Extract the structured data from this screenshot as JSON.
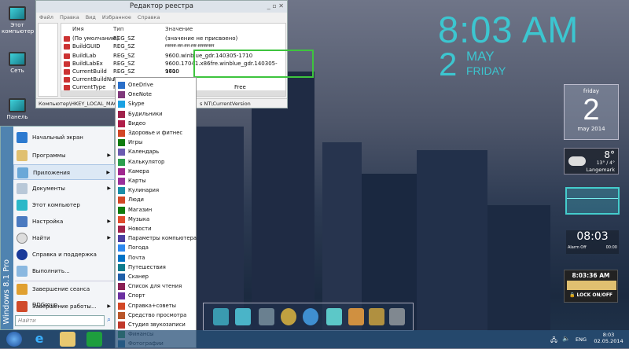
{
  "desktop_icons": [
    "Этот компьютер",
    "Сеть",
    "Панель"
  ],
  "regedit": {
    "title": "Редактор реестра",
    "menu": [
      "Файл",
      "Правка",
      "Вид",
      "Избранное",
      "Справка"
    ],
    "columns": [
      "Имя",
      "Тип",
      "Значение"
    ],
    "rows": [
      {
        "name": "(По умолчанию)",
        "type": "REG_SZ",
        "value": "(значение не присвоено)"
      },
      {
        "name": "BuildGUID",
        "type": "REG_SZ",
        "value": "ffffffff-ffff-ffff-ffff-ffffffffffff"
      },
      {
        "name": "BuildLab",
        "type": "REG_SZ",
        "value": "9600.winblue_gdr.140305-1710"
      },
      {
        "name": "BuildLabEx",
        "type": "REG_SZ",
        "value": "9600.17041.x86fre.winblue_gdr.140305-1710"
      },
      {
        "name": "CurrentBuild",
        "type": "REG_SZ",
        "value": "9600"
      },
      {
        "name": "CurrentBuildNu...",
        "type": "RE",
        "value": ""
      },
      {
        "name": "CurrentType",
        "type": "RE",
        "value": "Free"
      }
    ],
    "status": "Компьютер\\HKEY_LOCAL_MACH",
    "status_tail": "s NT\\CurrentVersion"
  },
  "start_menu": {
    "edition": "Windows 8.1 Pro",
    "items": [
      "Начальный экран",
      "Программы",
      "Приложения",
      "Документы",
      "Этот компьютер",
      "Настройка",
      "Найти",
      "Справка и поддержка",
      "Выполнить...",
      "Завершение сеанса DDGroup...",
      "Завершение работы..."
    ],
    "search_placeholder": "Найти"
  },
  "apps": [
    "OneDrive",
    "OneNote",
    "Skype",
    "Будильники",
    "Видео",
    "Здоровье и фитнес",
    "Игры",
    "Календарь",
    "Калькулятор",
    "Камера",
    "Карты",
    "Кулинария",
    "Люди",
    "Магазин",
    "Музыка",
    "Новости",
    "Параметры компьютера",
    "Погода",
    "Почта",
    "Путешествия",
    "Сканер",
    "Список для чтения",
    "Спорт",
    "Справка+советы",
    "Средство просмотра",
    "Студия звукозаписи",
    "Финансы",
    "Фотографии"
  ],
  "app_colors": [
    "#2a6fc9",
    "#80397b",
    "#1ba1e2",
    "#a0224a",
    "#b01e4a",
    "#d24726",
    "#107c10",
    "#6b5bb1",
    "#2d9f4f",
    "#a0288f",
    "#9b2f9b",
    "#1b8ea8",
    "#d24726",
    "#107c10",
    "#e04b2d",
    "#a0224a",
    "#4b3fa0",
    "#2d89ef",
    "#0072c6",
    "#0f7c8c",
    "#1f5fa8",
    "#8a2054",
    "#6b2fa0",
    "#d24726",
    "#b8562a",
    "#c0392b",
    "#2d9f4f",
    "#1f6f9f"
  ],
  "clock": {
    "time": "8:03 AM",
    "day": "2",
    "month": "MAY",
    "weekday": "FRIDAY"
  },
  "calendar_widget": {
    "weekday": "friday",
    "day": "2",
    "month_year": "may 2014"
  },
  "weather": {
    "temp": "8°",
    "range": "13° / 4°",
    "city": "Langemark"
  },
  "alarm_clock": {
    "time": "08:03",
    "label": "Alarm Off",
    "alarm_time": "00:00"
  },
  "digital_clock": {
    "time": "8:03:36 AM",
    "lock_label": "LOCK ON/OFF"
  },
  "tray": {
    "lang": "ENG",
    "time": "8:03",
    "date": "02.05.2014"
  }
}
